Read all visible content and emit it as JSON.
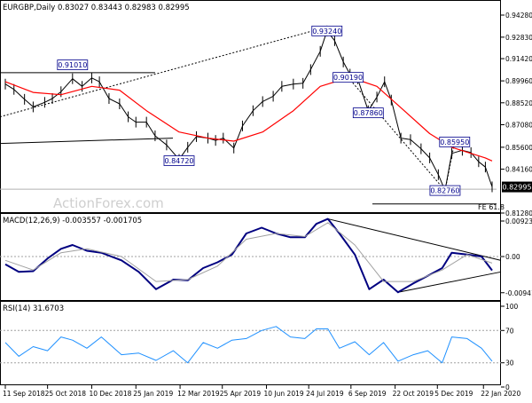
{
  "chart_data": [
    {
      "type": "line",
      "panel": "price",
      "title": "EURGBP,Daily  0.83027 0.83443 0.82983 0.82995",
      "symbol": "EURGBP",
      "timeframe": "Daily",
      "ohlc_readout": {
        "open": 0.83027,
        "high": 0.83443,
        "low": 0.82983,
        "close": 0.82995
      },
      "ylim": [
        0.812,
        0.946
      ],
      "y_ticks": [
        "0.94280",
        "0.92830",
        "0.91420",
        "0.89960",
        "0.88520",
        "0.87080",
        "0.85600",
        "0.84160",
        "0.82720",
        "0.81280"
      ],
      "x_ticks": [
        "11 Sep 2018",
        "25 Oct 2018",
        "10 Dec 2018",
        "25 Jan 2019",
        "12 Mar 2019",
        "25 Apr 2019",
        "10 Jun 2019",
        "24 Jul 2019",
        "6 Sep 2019",
        "22 Oct 2019",
        "5 Dec 2019",
        "22 Jan 2020"
      ],
      "watermark": "ActionForex.com",
      "current_price_label": "0.82995",
      "price_annotations": [
        {
          "label": "0.91010",
          "value": 0.9101,
          "date": "2018-11-20"
        },
        {
          "label": "0.84720",
          "value": 0.8472,
          "date": "2019-03-11"
        },
        {
          "label": "0.93240",
          "value": 0.9324,
          "date": "2019-08-12"
        },
        {
          "label": "0.90190",
          "value": 0.9019,
          "date": "2019-09-03"
        },
        {
          "label": "0.87860",
          "value": 0.8786,
          "date": "2019-09-24"
        },
        {
          "label": "0.85950",
          "value": 0.8595,
          "date": "2019-12-23"
        },
        {
          "label": "0.82760",
          "value": 0.8276,
          "date": "2019-12-13"
        }
      ],
      "fe_label": "FE 61.8",
      "series": [
        {
          "role": "close",
          "color": "#000000",
          "x": [
            "2018-09-11",
            "2018-09-20",
            "2018-10-01",
            "2018-10-10",
            "2018-10-22",
            "2018-10-30",
            "2018-11-08",
            "2018-11-20",
            "2018-11-30",
            "2018-12-10",
            "2018-12-18",
            "2018-12-28",
            "2019-01-08",
            "2019-01-17",
            "2019-01-25",
            "2019-02-05",
            "2019-02-14",
            "2019-02-26",
            "2019-03-11",
            "2019-03-20",
            "2019-03-29",
            "2019-04-10",
            "2019-04-18",
            "2019-04-26",
            "2019-05-07",
            "2019-05-16",
            "2019-05-27",
            "2019-06-06",
            "2019-06-17",
            "2019-06-26",
            "2019-07-08",
            "2019-07-18",
            "2019-07-26",
            "2019-08-05",
            "2019-08-12",
            "2019-08-20",
            "2019-08-29",
            "2019-09-05",
            "2019-09-13",
            "2019-09-24",
            "2019-10-03",
            "2019-10-11",
            "2019-10-18",
            "2019-10-28",
            "2019-11-07",
            "2019-11-18",
            "2019-11-27",
            "2019-12-06",
            "2019-12-13",
            "2019-12-20",
            "2019-12-31",
            "2020-01-09",
            "2020-01-17",
            "2020-01-24",
            "2020-01-31"
          ],
          "values": [
            0.8975,
            0.894,
            0.8875,
            0.8825,
            0.8855,
            0.888,
            0.8925,
            0.901,
            0.896,
            0.9015,
            0.899,
            0.888,
            0.8845,
            0.876,
            0.8725,
            0.8725,
            0.8635,
            0.8575,
            0.848,
            0.856,
            0.863,
            0.862,
            0.8605,
            0.862,
            0.8555,
            0.87,
            0.88,
            0.886,
            0.8895,
            0.896,
            0.8975,
            0.898,
            0.907,
            0.919,
            0.9324,
            0.926,
            0.912,
            0.904,
            0.901,
            0.88,
            0.889,
            0.899,
            0.887,
            0.862,
            0.861,
            0.855,
            0.849,
            0.838,
            0.8276,
            0.852,
            0.854,
            0.8525,
            0.8465,
            0.843,
            0.83
          ]
        },
        {
          "role": "moving_average",
          "color": "#ff0000",
          "x": [
            "2018-09-11",
            "2018-10-10",
            "2018-11-08",
            "2018-12-10",
            "2019-01-08",
            "2019-02-05",
            "2019-03-11",
            "2019-04-10",
            "2019-05-07",
            "2019-06-06",
            "2019-07-08",
            "2019-08-05",
            "2019-09-05",
            "2019-10-03",
            "2019-10-28",
            "2019-11-27",
            "2019-12-20",
            "2020-01-24",
            "2020-01-31"
          ],
          "values": [
            0.899,
            0.892,
            0.8905,
            0.896,
            0.8935,
            0.88,
            0.866,
            0.862,
            0.86,
            0.866,
            0.88,
            0.896,
            0.902,
            0.896,
            0.882,
            0.865,
            0.856,
            0.849,
            0.847
          ]
        }
      ]
    },
    {
      "type": "line",
      "panel": "macd",
      "title": "MACD(12,26,9) -0.003557 -0.001705",
      "readout": {
        "macd": -0.003557,
        "signal": -0.001705
      },
      "ylim": [
        -0.0112,
        0.0106
      ],
      "y_ticks": [
        "0.009237",
        "0.00",
        "-0.009413"
      ],
      "series": [
        {
          "role": "macd",
          "color": "#000080",
          "x": [
            "2018-09-11",
            "2018-09-25",
            "2018-10-10",
            "2018-10-25",
            "2018-11-08",
            "2018-11-20",
            "2018-12-05",
            "2018-12-20",
            "2019-01-10",
            "2019-01-28",
            "2019-02-15",
            "2019-03-05",
            "2019-03-20",
            "2019-04-05",
            "2019-04-20",
            "2019-05-05",
            "2019-05-20",
            "2019-06-05",
            "2019-06-20",
            "2019-07-05",
            "2019-07-20",
            "2019-08-01",
            "2019-08-13",
            "2019-08-25",
            "2019-09-10",
            "2019-09-25",
            "2019-10-10",
            "2019-10-25",
            "2019-11-10",
            "2019-11-25",
            "2019-12-10",
            "2019-12-20",
            "2020-01-05",
            "2020-01-20",
            "2020-01-31"
          ],
          "values": [
            -0.002,
            -0.004,
            -0.0038,
            -0.0005,
            0.002,
            0.003,
            0.0015,
            0.001,
            -0.001,
            -0.004,
            -0.0085,
            -0.006,
            -0.0062,
            -0.003,
            -0.0015,
            0.0005,
            0.006,
            0.0075,
            0.006,
            0.005,
            0.005,
            0.0085,
            0.0098,
            0.006,
            0.0005,
            -0.0085,
            -0.006,
            -0.0093,
            -0.007,
            -0.005,
            -0.003,
            0.001,
            0.0005,
            0.0,
            -0.0036
          ]
        },
        {
          "role": "signal",
          "color": "#a0a0a0",
          "x": [
            "2018-09-11",
            "2018-10-10",
            "2018-11-08",
            "2018-12-05",
            "2019-01-10",
            "2019-02-15",
            "2019-03-20",
            "2019-04-20",
            "2019-05-20",
            "2019-06-20",
            "2019-07-20",
            "2019-08-13",
            "2019-09-10",
            "2019-10-10",
            "2019-11-10",
            "2019-12-10",
            "2020-01-05",
            "2020-01-31"
          ],
          "values": [
            -0.001,
            -0.0035,
            0.001,
            0.002,
            0.0,
            -0.0065,
            -0.006,
            -0.0025,
            0.0045,
            0.006,
            0.0052,
            0.0088,
            0.003,
            -0.0065,
            -0.0065,
            -0.0035,
            0.0005,
            -0.0017
          ]
        }
      ]
    },
    {
      "type": "line",
      "panel": "rsi",
      "title": "RSI(14) 31.6703",
      "readout": {
        "rsi": 31.6703
      },
      "ylim": [
        0,
        100
      ],
      "y_ticks": [
        "100",
        "70",
        "30",
        "0"
      ],
      "levels": [
        70,
        30
      ],
      "series": [
        {
          "role": "rsi",
          "color": "#1e90ff",
          "x": [
            "2018-09-11",
            "2018-09-25",
            "2018-10-10",
            "2018-10-25",
            "2018-11-08",
            "2018-11-20",
            "2018-12-05",
            "2018-12-20",
            "2019-01-10",
            "2019-01-28",
            "2019-02-15",
            "2019-03-05",
            "2019-03-20",
            "2019-04-05",
            "2019-04-20",
            "2019-05-05",
            "2019-05-20",
            "2019-06-05",
            "2019-06-20",
            "2019-07-05",
            "2019-07-20",
            "2019-08-01",
            "2019-08-13",
            "2019-08-25",
            "2019-09-10",
            "2019-09-25",
            "2019-10-10",
            "2019-10-25",
            "2019-11-10",
            "2019-11-25",
            "2019-12-10",
            "2019-12-20",
            "2020-01-05",
            "2020-01-20",
            "2020-01-31"
          ],
          "values": [
            55,
            38,
            50,
            45,
            62,
            58,
            48,
            62,
            40,
            42,
            33,
            45,
            30,
            55,
            48,
            58,
            60,
            70,
            75,
            62,
            60,
            72,
            72,
            48,
            56,
            40,
            55,
            32,
            40,
            45,
            30,
            62,
            60,
            48,
            32
          ]
        }
      ]
    }
  ]
}
